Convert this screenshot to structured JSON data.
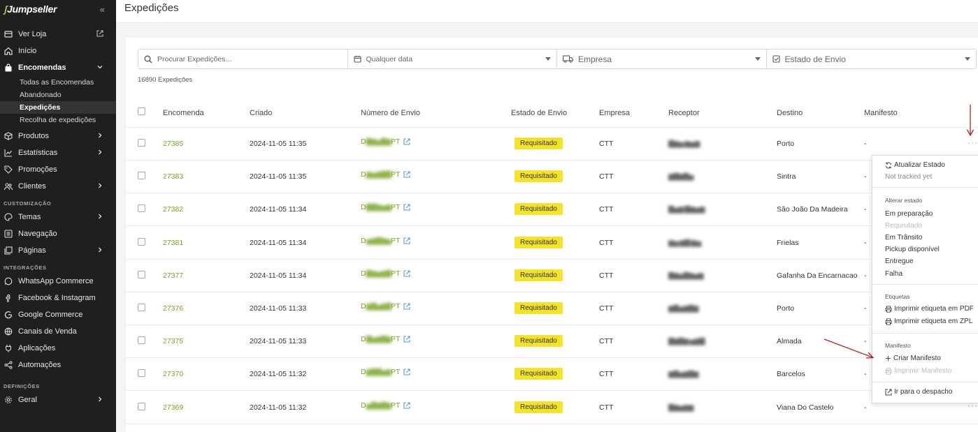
{
  "sidebar": {
    "logo": "Jumpseller",
    "view_store": "Ver Loja",
    "home": "Início",
    "orders": "Encomendas",
    "orders_sub": [
      "Todas as Encomendas",
      "Abandonado",
      "Expedições",
      "Recolha de expedições"
    ],
    "products": "Produtos",
    "stats": "Estatísticas",
    "promotions": "Promoções",
    "clients": "Clientes",
    "section_custom": "CUSTOMIZAÇÃO",
    "themes": "Temas",
    "navigation": "Navegação",
    "pages": "Páginas",
    "section_integrations": "INTEGRAÇÕES",
    "whatsapp": "WhatsApp Commerce",
    "facebook": "Facebook & Instagram",
    "google": "Google Commerce",
    "channels": "Canais de Venda",
    "apps": "Aplicações",
    "automations": "Automações",
    "section_settings": "DEFINIÇÕES",
    "general": "Geral"
  },
  "header": {
    "title": "Expedições"
  },
  "filters": {
    "search_placeholder": "Procurar Expedições...",
    "date": "Qualquer data",
    "company": "Empresa",
    "state": "Estado de Envio"
  },
  "count": "16890 Expedições",
  "table": {
    "columns": [
      "Encomenda",
      "Criado",
      "Número de Envio",
      "Estado de Envio",
      "Empresa",
      "Receptor",
      "Destino",
      "Manifesto"
    ],
    "rows": [
      {
        "order": "27385",
        "created": "2024-11-05 11:35",
        "ship_prefix": "D",
        "ship_suffix": "PT",
        "status": "Requisitado",
        "company": "CTT",
        "dest": "Porto",
        "manifest": "-"
      },
      {
        "order": "27383",
        "created": "2024-11-05 11:35",
        "ship_prefix": "D",
        "ship_suffix": "PT",
        "status": "Requisitado",
        "company": "CTT",
        "dest": "Sintra",
        "manifest": "-"
      },
      {
        "order": "27382",
        "created": "2024-11-05 11:34",
        "ship_prefix": "D",
        "ship_suffix": "PT",
        "status": "Requisitado",
        "company": "CTT",
        "dest": "São João Da Madeira",
        "manifest": "-"
      },
      {
        "order": "27381",
        "created": "2024-11-05 11:34",
        "ship_prefix": "D",
        "ship_suffix": "PT",
        "status": "Requisitado",
        "company": "CTT",
        "dest": "Frielas",
        "manifest": "-"
      },
      {
        "order": "27377",
        "created": "2024-11-05 11:34",
        "ship_prefix": "D",
        "ship_suffix": "PT",
        "status": "Requisitado",
        "company": "CTT",
        "dest": "Gafanha Da Encarnacao",
        "manifest": "-"
      },
      {
        "order": "27376",
        "created": "2024-11-05 11:33",
        "ship_prefix": "D",
        "ship_suffix": "PT",
        "status": "Requisitado",
        "company": "CTT",
        "dest": "Porto",
        "manifest": "-"
      },
      {
        "order": "27375",
        "created": "2024-11-05 11:33",
        "ship_prefix": "D",
        "ship_suffix": "PT",
        "status": "Requisitado",
        "company": "CTT",
        "dest": "Almada",
        "manifest": "-"
      },
      {
        "order": "27370",
        "created": "2024-11-05 11:32",
        "ship_prefix": "D",
        "ship_suffix": "PT",
        "status": "Requisitado",
        "company": "CTT",
        "dest": "Barcelos",
        "manifest": "-"
      },
      {
        "order": "27369",
        "created": "2024-11-05 11:32",
        "ship_prefix": "D",
        "ship_suffix": "PT",
        "status": "Requisitado",
        "company": "CTT",
        "dest": "Viana Do Castelo",
        "manifest": "-"
      }
    ]
  },
  "menu": {
    "update_state": "Atualizar Estado",
    "not_tracked": "Not tracked yet",
    "change_state_head": "Alterar estado",
    "states": [
      "Em preparação",
      "Requisitado",
      "Em Trânsito",
      "Pickup disponível",
      "Entregue",
      "Falha"
    ],
    "labels_head": "Etiquetas",
    "print_pdf": "Imprimir etiqueta em PDF",
    "print_zpl": "Imprimir etiqueta em ZPL",
    "manifest_head": "Manifesto",
    "create_manifest": "Criar Manifesto",
    "print_manifest": "Imprimir Manifesto",
    "goto_dispatch": "Ir para o despacho"
  },
  "colors": {
    "accent": "#7aa61f",
    "badge": "#f5e32a",
    "sidebar": "#1f1f1f",
    "arrow": "#b22222"
  }
}
